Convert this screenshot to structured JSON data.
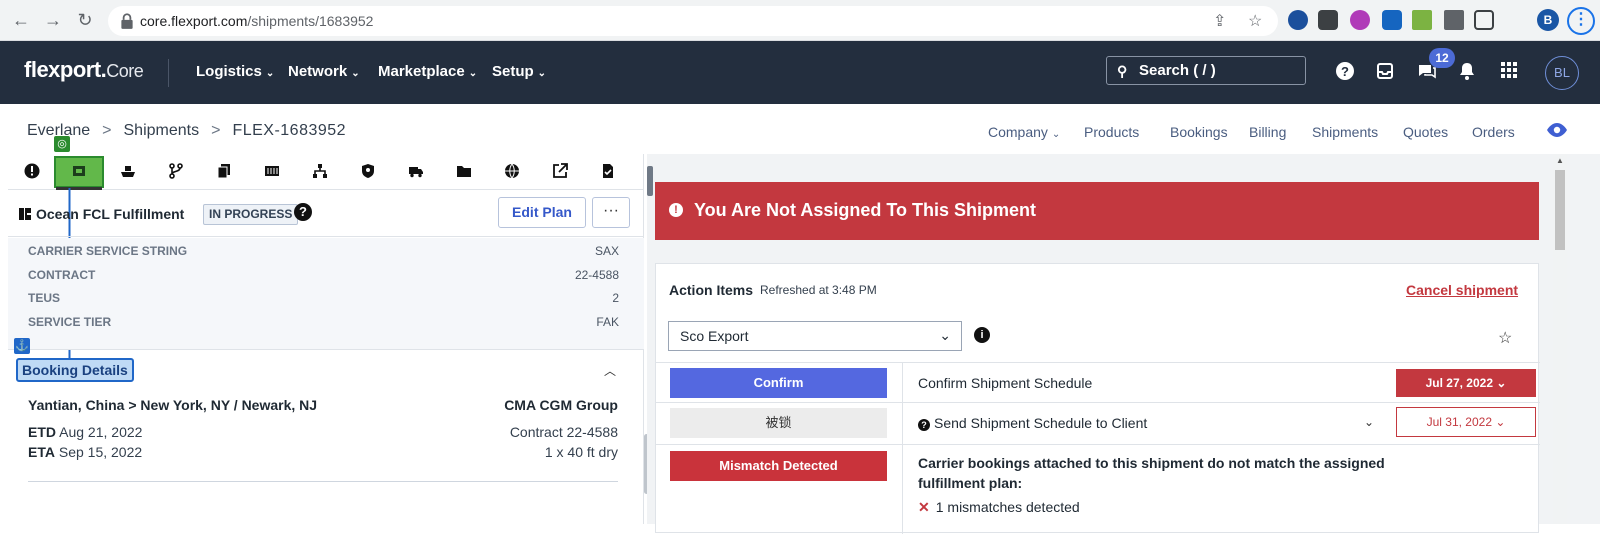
{
  "browser": {
    "url_host": "core.flexport.com",
    "url_path": "/shipments/1683952",
    "profile_initial": "B"
  },
  "header": {
    "logo": "flexport.",
    "logo_suffix": "Core",
    "nav": [
      {
        "label": "Logistics"
      },
      {
        "label": "Network"
      },
      {
        "label": "Marketplace"
      },
      {
        "label": "Setup"
      }
    ],
    "search_label": "Search ( / )",
    "notification_count": "12",
    "user_initials": "BL"
  },
  "breadcrumb": {
    "items": [
      "Everlane",
      "Shipments",
      "FLEX-1683952"
    ]
  },
  "toplinks": [
    {
      "label": "Company",
      "has_dropdown": true
    },
    {
      "label": "Products"
    },
    {
      "label": "Bookings"
    },
    {
      "label": "Billing"
    },
    {
      "label": "Shipments"
    },
    {
      "label": "Quotes"
    },
    {
      "label": "Orders"
    }
  ],
  "left": {
    "tab_icons": [
      "info-icon",
      "fulfillment-icon",
      "ship-icon",
      "route-icon",
      "documents-icon",
      "container-icon",
      "network-icon",
      "security-icon",
      "truck-icon",
      "folder-icon",
      "globe-icon",
      "external-link-icon",
      "checklist-icon"
    ],
    "fulfillment_title": "Ocean FCL Fulfillment",
    "status": "IN PROGRESS",
    "edit_plan_label": "Edit Plan",
    "more_label": "···",
    "details": [
      {
        "key": "CARRIER SERVICE STRING",
        "value": "SAX"
      },
      {
        "key": "CONTRACT",
        "value": "22-4588"
      },
      {
        "key": "TEUS",
        "value": "2"
      },
      {
        "key": "SERVICE TIER",
        "value": "FAK"
      }
    ],
    "booking_details_label": "Booking Details",
    "route": "Yantian, China > New York, NY / Newark, NJ",
    "carrier": "CMA CGM Group",
    "etd_label": "ETD",
    "etd": "Aug 21, 2022",
    "eta_label": "ETA",
    "eta": "Sep 15, 2022",
    "contract": "Contract 22-4588",
    "equipment": "1 x 40 ft dry"
  },
  "right": {
    "warning": "You Are Not Assigned To This Shipment",
    "actions_title": "Action Items",
    "refreshed": "Refreshed at 3:48 PM",
    "cancel_label": "Cancel shipment",
    "filter_value": "Sco Export",
    "tasks": [
      {
        "button": "Confirm",
        "text": "Confirm Shipment Schedule",
        "due": "Jul 27, 2022"
      },
      {
        "button": "被锁",
        "text": "Send Shipment Schedule to Client",
        "due": "Jul 31, 2022"
      },
      {
        "button": "Mismatch Detected",
        "text": "Carrier bookings attached to this shipment do not match the assigned fulfillment plan:",
        "detail": "1 mismatches detected"
      }
    ]
  },
  "colors": {
    "header_bg": "#232e3e",
    "accent_blue": "#5468e0",
    "danger_red": "#c3383f",
    "highlight_green": "#62b84a",
    "highlight_blue": "#2067c8"
  }
}
